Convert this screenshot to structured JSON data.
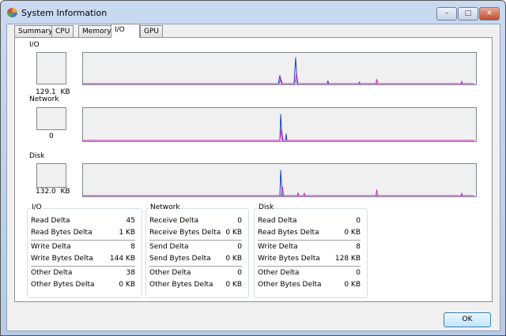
{
  "window": {
    "title": "System Information"
  },
  "tabs": [
    {
      "label": "Summary"
    },
    {
      "label": "CPU"
    },
    {
      "label": "Memory"
    },
    {
      "label": "I/O"
    },
    {
      "label": "GPU"
    }
  ],
  "graphs": {
    "io": {
      "label": "I/O",
      "value": "129.1  KB"
    },
    "network": {
      "label": "Network",
      "value": "0"
    },
    "disk": {
      "label": "Disk",
      "value": "132.0  KB"
    }
  },
  "groups": [
    {
      "title": "I/O",
      "rows": [
        [
          "Read Delta",
          "45"
        ],
        [
          "Read Bytes Delta",
          "1 KB"
        ],
        [
          "Write Delta",
          "8"
        ],
        [
          "Write Bytes Delta",
          "144 KB"
        ],
        [
          "Other Delta",
          "38"
        ],
        [
          "Other Bytes Delta",
          "0 KB"
        ]
      ]
    },
    {
      "title": "Network",
      "rows": [
        [
          "Receive Delta",
          "0"
        ],
        [
          "Receive Bytes Delta",
          "0 KB"
        ],
        [
          "Send Delta",
          "0"
        ],
        [
          "Send Bytes Delta",
          "0 KB"
        ],
        [
          "Other Delta",
          "0"
        ],
        [
          "Other Bytes Delta",
          "0 KB"
        ]
      ]
    },
    {
      "title": "Disk",
      "rows": [
        [
          "Read Delta",
          "0"
        ],
        [
          "Read Bytes Delta",
          "0 KB"
        ],
        [
          "Write Delta",
          "8"
        ],
        [
          "Write Bytes Delta",
          "128 KB"
        ],
        [
          "Other Delta",
          "0"
        ],
        [
          "Other Bytes Delta",
          "0 KB"
        ]
      ]
    }
  ],
  "buttons": {
    "ok": "OK"
  },
  "colors": {
    "read": "#1f3fbf",
    "write": "#d020c0"
  }
}
